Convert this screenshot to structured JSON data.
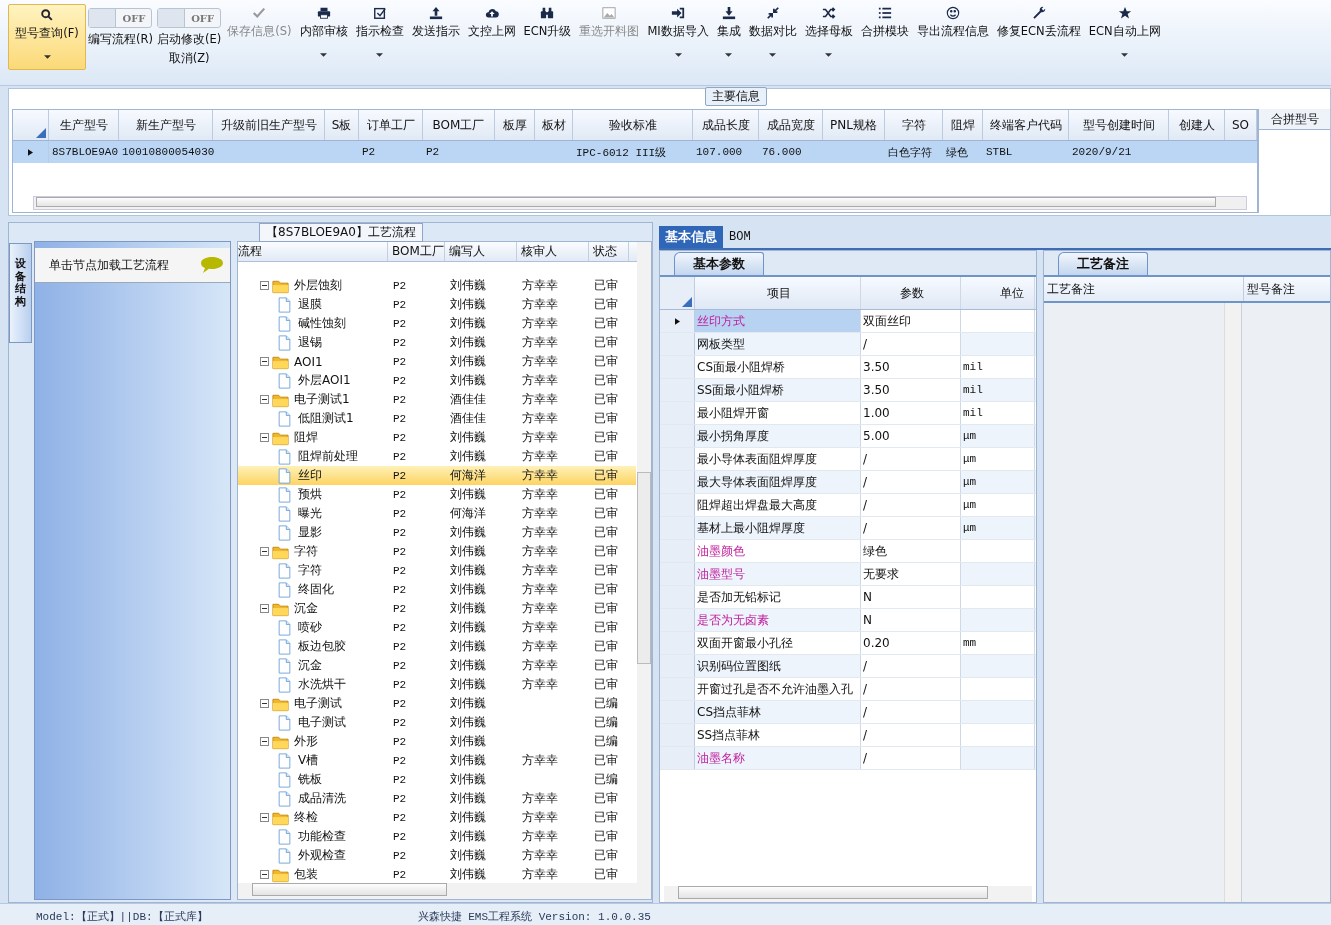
{
  "toolbar": [
    {
      "kind": "button",
      "label": "型号查询(F)",
      "selected": true,
      "disabled": false,
      "dropdown": true
    },
    {
      "kind": "toggle",
      "switch_text": "OFF",
      "on": false,
      "label": "编写流程(R)"
    },
    {
      "kind": "toggle",
      "switch_text": "OFF",
      "on": false,
      "label": "启动修改(E)",
      "note": "取消(Z)"
    },
    {
      "kind": "button",
      "label": "保存信息(S)",
      "selected": false,
      "disabled": true,
      "dropdown": false
    },
    {
      "kind": "button",
      "label": "内部审核",
      "selected": false,
      "disabled": false,
      "dropdown": true
    },
    {
      "kind": "button",
      "label": "指示检查",
      "selected": false,
      "disabled": false,
      "dropdown": true
    },
    {
      "kind": "button",
      "label": "发送指示",
      "selected": false,
      "disabled": false,
      "dropdown": false
    },
    {
      "kind": "button",
      "label": "文控上网",
      "selected": false,
      "disabled": false,
      "dropdown": false
    },
    {
      "kind": "button",
      "label": "ECN升级",
      "selected": false,
      "disabled": false,
      "dropdown": false
    },
    {
      "kind": "button",
      "label": "重选开料图",
      "selected": false,
      "disabled": true,
      "dropdown": false
    },
    {
      "kind": "button",
      "label": "MI数据导入",
      "selected": false,
      "disabled": false,
      "dropdown": true
    },
    {
      "kind": "button",
      "label": "集成",
      "selected": false,
      "disabled": false,
      "dropdown": true
    },
    {
      "kind": "button",
      "label": "数据对比",
      "selected": false,
      "disabled": false,
      "dropdown": true
    },
    {
      "kind": "button",
      "label": "选择母板",
      "selected": false,
      "disabled": false,
      "dropdown": true
    },
    {
      "kind": "button",
      "label": "合拼模块",
      "selected": false,
      "disabled": false,
      "dropdown": false
    },
    {
      "kind": "button",
      "label": "导出流程信息",
      "selected": false,
      "disabled": false,
      "dropdown": false
    },
    {
      "kind": "button",
      "label": "修复ECN丢流程",
      "selected": false,
      "disabled": false,
      "dropdown": false
    },
    {
      "kind": "button",
      "label": "ECN自动上网",
      "selected": false,
      "disabled": false,
      "dropdown": true
    }
  ],
  "main_info": {
    "title": "主要信息",
    "columns": [
      "生产型号",
      "新生产型号",
      "升级前旧生产型号",
      "S板",
      "订单工厂",
      "BOM工厂",
      "板厚",
      "板材",
      "验收标准",
      "成品长度",
      "成品宽度",
      "PNL规格",
      "字符",
      "阻焊",
      "终端客户代码",
      "型号创建时间",
      "创建人",
      "SO"
    ],
    "rows": [
      {
        "selected": true,
        "cells": [
          "8S7BLOE9A0",
          "10010800054030",
          "",
          "",
          "P2",
          "P2",
          "",
          "",
          "IPC-6012 III级",
          "107.000",
          "76.000",
          "",
          "白色字符",
          "绿色",
          "STBL",
          "2020/9/21",
          "",
          ""
        ]
      }
    ],
    "side_column": "合拼型号"
  },
  "process_panel": {
    "title": "【8S7BLOE9A0】工艺流程",
    "side_tab": "设备结构",
    "hint": "单击节点加载工艺流程",
    "columns": [
      "流程",
      "BOM工厂",
      "编写人",
      "核审人",
      "状态"
    ],
    "rows": [
      {
        "name": "外层蚀刻",
        "bom": "P2",
        "writer": "刘伟巍",
        "reviewer": "方幸幸",
        "status": "已审",
        "selected": false,
        "expanded": true,
        "children": [
          {
            "name": "退膜",
            "bom": "P2",
            "writer": "刘伟巍",
            "reviewer": "方幸幸",
            "status": "已审",
            "selected": false
          },
          {
            "name": "碱性蚀刻",
            "bom": "P2",
            "writer": "刘伟巍",
            "reviewer": "方幸幸",
            "status": "已审",
            "selected": false
          },
          {
            "name": "退锡",
            "bom": "P2",
            "writer": "刘伟巍",
            "reviewer": "方幸幸",
            "status": "已审",
            "selected": false
          }
        ]
      },
      {
        "name": "AOI1",
        "bom": "P2",
        "writer": "刘伟巍",
        "reviewer": "方幸幸",
        "status": "已审",
        "selected": false,
        "expanded": true,
        "children": [
          {
            "name": "外层AOI1",
            "bom": "P2",
            "writer": "刘伟巍",
            "reviewer": "方幸幸",
            "status": "已审",
            "selected": false
          }
        ]
      },
      {
        "name": "电子测试1",
        "bom": "P2",
        "writer": "酒佳佳",
        "reviewer": "方幸幸",
        "status": "已审",
        "selected": false,
        "expanded": true,
        "children": [
          {
            "name": "低阻测试1",
            "bom": "P2",
            "writer": "酒佳佳",
            "reviewer": "方幸幸",
            "status": "已审",
            "selected": false
          }
        ]
      },
      {
        "name": "阻焊",
        "bom": "P2",
        "writer": "刘伟巍",
        "reviewer": "方幸幸",
        "status": "已审",
        "selected": false,
        "expanded": true,
        "children": [
          {
            "name": "阻焊前处理",
            "bom": "P2",
            "writer": "刘伟巍",
            "reviewer": "方幸幸",
            "status": "已审",
            "selected": false
          },
          {
            "name": "丝印",
            "bom": "P2",
            "writer": "何海洋",
            "reviewer": "方幸幸",
            "status": "已审",
            "selected": true
          },
          {
            "name": "预烘",
            "bom": "P2",
            "writer": "刘伟巍",
            "reviewer": "方幸幸",
            "status": "已审",
            "selected": false
          },
          {
            "name": "曝光",
            "bom": "P2",
            "writer": "何海洋",
            "reviewer": "方幸幸",
            "status": "已审",
            "selected": false
          },
          {
            "name": "显影",
            "bom": "P2",
            "writer": "刘伟巍",
            "reviewer": "方幸幸",
            "status": "已审",
            "selected": false
          }
        ]
      },
      {
        "name": "字符",
        "bom": "P2",
        "writer": "刘伟巍",
        "reviewer": "方幸幸",
        "status": "已审",
        "selected": false,
        "expanded": true,
        "children": [
          {
            "name": "字符",
            "bom": "P2",
            "writer": "刘伟巍",
            "reviewer": "方幸幸",
            "status": "已审",
            "selected": false
          },
          {
            "name": "终固化",
            "bom": "P2",
            "writer": "刘伟巍",
            "reviewer": "方幸幸",
            "status": "已审",
            "selected": false
          }
        ]
      },
      {
        "name": "沉金",
        "bom": "P2",
        "writer": "刘伟巍",
        "reviewer": "方幸幸",
        "status": "已审",
        "selected": false,
        "expanded": true,
        "children": [
          {
            "name": "喷砂",
            "bom": "P2",
            "writer": "刘伟巍",
            "reviewer": "方幸幸",
            "status": "已审",
            "selected": false
          },
          {
            "name": "板边包胶",
            "bom": "P2",
            "writer": "刘伟巍",
            "reviewer": "方幸幸",
            "status": "已审",
            "selected": false
          },
          {
            "name": "沉金",
            "bom": "P2",
            "writer": "刘伟巍",
            "reviewer": "方幸幸",
            "status": "已审",
            "selected": false
          },
          {
            "name": "水洗烘干",
            "bom": "P2",
            "writer": "刘伟巍",
            "reviewer": "方幸幸",
            "status": "已审",
            "selected": false
          }
        ]
      },
      {
        "name": "电子测试",
        "bom": "P2",
        "writer": "刘伟巍",
        "status": "已编",
        "selected": false,
        "expanded": true,
        "children": [
          {
            "name": "电子测试",
            "bom": "P2",
            "writer": "刘伟巍",
            "status": "已编",
            "selected": false
          }
        ]
      },
      {
        "name": "外形",
        "bom": "P2",
        "writer": "刘伟巍",
        "status": "已编",
        "selected": false,
        "expanded": true,
        "children": [
          {
            "name": "V槽",
            "bom": "P2",
            "writer": "刘伟巍",
            "reviewer": "方幸幸",
            "status": "已审",
            "selected": false
          },
          {
            "name": "铣板",
            "bom": "P2",
            "writer": "刘伟巍",
            "status": "已编",
            "selected": false
          },
          {
            "name": "成品清洗",
            "bom": "P2",
            "writer": "刘伟巍",
            "reviewer": "方幸幸",
            "status": "已审",
            "selected": false
          }
        ]
      },
      {
        "name": "终检",
        "bom": "P2",
        "writer": "刘伟巍",
        "reviewer": "方幸幸",
        "status": "已审",
        "selected": false,
        "expanded": true,
        "children": [
          {
            "name": "功能检查",
            "bom": "P2",
            "writer": "刘伟巍",
            "reviewer": "方幸幸",
            "status": "已审",
            "selected": false
          },
          {
            "name": "外观检查",
            "bom": "P2",
            "writer": "刘伟巍",
            "reviewer": "方幸幸",
            "status": "已审",
            "selected": false
          }
        ]
      },
      {
        "name": "包装",
        "bom": "P2",
        "writer": "刘伟巍",
        "reviewer": "方幸幸",
        "status": "已审",
        "selected": false,
        "expanded": true
      }
    ]
  },
  "detail_tabs": [
    {
      "label": "基本信息",
      "selected": true
    },
    {
      "label": "BOM",
      "selected": false
    }
  ],
  "params": {
    "tab": "基本参数",
    "columns": [
      "项目",
      "参数",
      "单位"
    ],
    "rows": [
      {
        "item": "丝印方式",
        "value": "双面丝印",
        "highlighted": true,
        "selected": true
      },
      {
        "item": "网板类型",
        "value": "/",
        "highlighted": false,
        "selected": false
      },
      {
        "item": "CS面最小阻焊桥",
        "value": "3.50",
        "unit": "mil",
        "highlighted": false,
        "selected": false
      },
      {
        "item": "SS面最小阻焊桥",
        "value": "3.50",
        "unit": "mil",
        "highlighted": false,
        "selected": false
      },
      {
        "item": "最小阻焊开窗",
        "value": "1.00",
        "unit": "mil",
        "highlighted": false,
        "selected": false
      },
      {
        "item": "最小拐角厚度",
        "value": "5.00",
        "unit": "μm",
        "highlighted": false,
        "selected": false
      },
      {
        "item": "最小导体表面阻焊厚度",
        "value": "/",
        "unit": "μm",
        "highlighted": false,
        "selected": false
      },
      {
        "item": "最大导体表面阻焊厚度",
        "value": "/",
        "unit": "μm",
        "highlighted": false,
        "selected": false
      },
      {
        "item": "阻焊超出焊盘最大高度",
        "value": "/",
        "unit": "μm",
        "highlighted": false,
        "selected": false
      },
      {
        "item": "基材上最小阻焊厚度",
        "value": "/",
        "unit": "μm",
        "highlighted": false,
        "selected": false
      },
      {
        "item": "油墨颜色",
        "value": "绿色",
        "highlighted": true,
        "selected": false
      },
      {
        "item": "油墨型号",
        "value": "无要求",
        "highlighted": true,
        "selected": false
      },
      {
        "item": "是否加无铅标记",
        "value": "N",
        "highlighted": false,
        "selected": false
      },
      {
        "item": "是否为无卤素",
        "value": "N",
        "highlighted": true,
        "selected": false
      },
      {
        "item": "双面开窗最小孔径",
        "value": "0.20",
        "unit": "mm",
        "highlighted": false,
        "selected": false
      },
      {
        "item": "识别码位置图纸",
        "value": "/",
        "highlighted": false,
        "selected": false
      },
      {
        "item": "开窗过孔是否不允许油墨入孔",
        "value": "/",
        "highlighted": false,
        "selected": false
      },
      {
        "item": "CS挡点菲林",
        "value": "/",
        "highlighted": false,
        "selected": false
      },
      {
        "item": "SS挡点菲林",
        "value": "/",
        "highlighted": false,
        "selected": false
      },
      {
        "item": "油墨名称",
        "value": "/",
        "highlighted": true,
        "selected": false
      }
    ]
  },
  "notes": {
    "tab": "工艺备注",
    "columns": [
      "工艺备注",
      "型号备注"
    ]
  },
  "status_bar": {
    "left": "Model:【正式】||DB:【正式库】",
    "center": "兴森快捷 EMS工程系统 Version: 1.0.0.35"
  }
}
